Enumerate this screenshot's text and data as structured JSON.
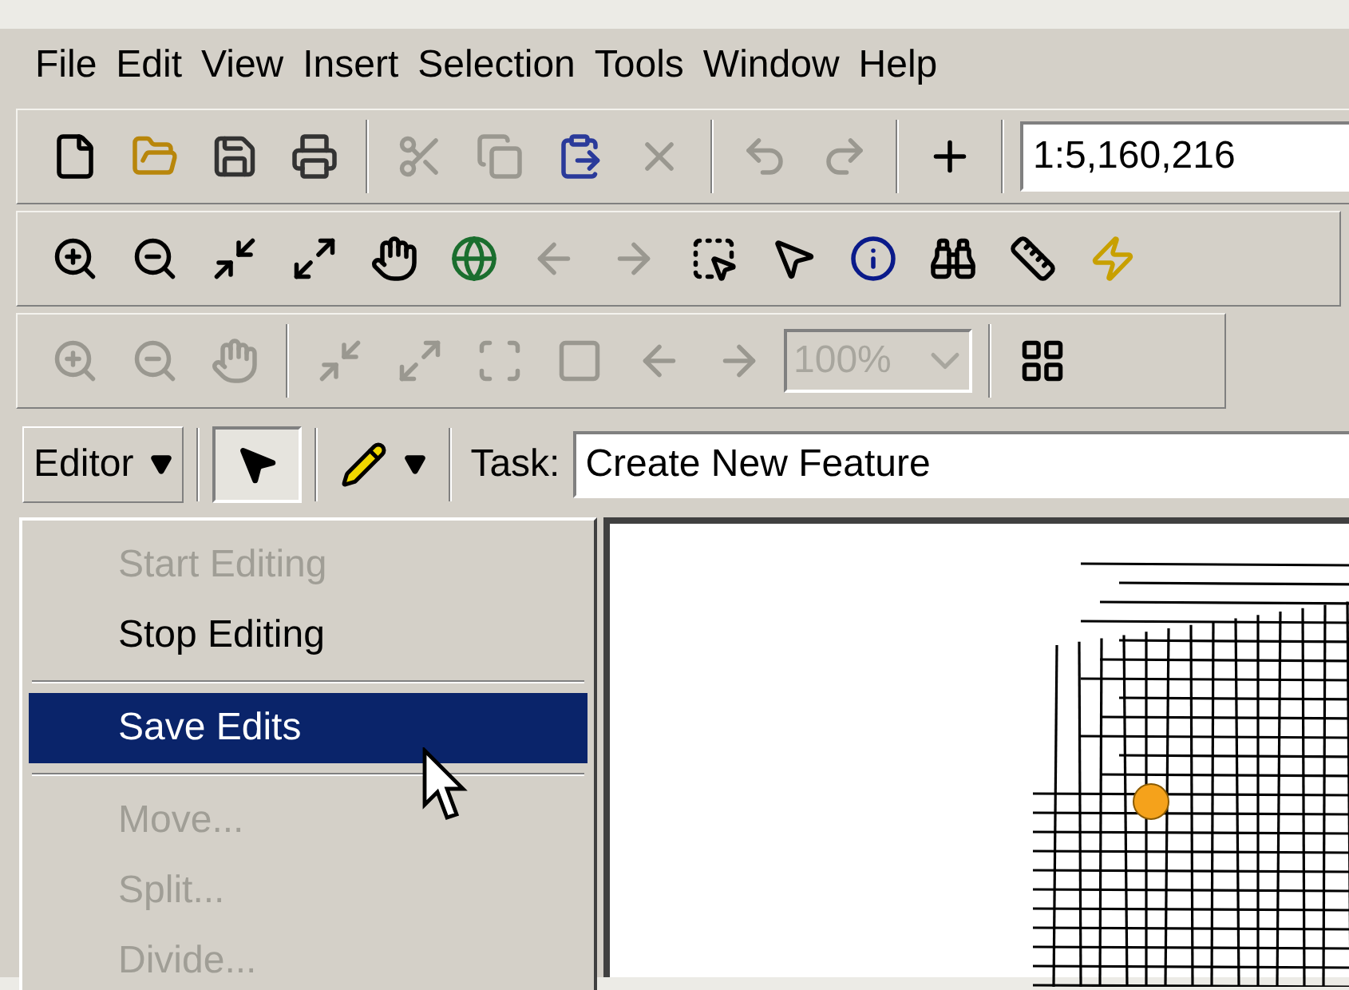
{
  "menu_bar": [
    {
      "label": "File"
    },
    {
      "label": "Edit"
    },
    {
      "label": "View"
    },
    {
      "label": "Insert"
    },
    {
      "label": "Selection"
    },
    {
      "label": "Tools"
    },
    {
      "label": "Window"
    },
    {
      "label": "Help"
    }
  ],
  "toolbars": [
    {
      "items": [
        {
          "kind": "button",
          "disabled": false
        },
        {
          "kind": "button",
          "disabled": false
        },
        {
          "kind": "button",
          "disabled": false
        },
        {
          "kind": "button",
          "disabled": false
        },
        {
          "kind": "separator"
        },
        {
          "kind": "button",
          "disabled": true
        },
        {
          "kind": "button",
          "disabled": true
        },
        {
          "kind": "button",
          "disabled": false
        },
        {
          "kind": "button",
          "disabled": true
        },
        {
          "kind": "separator"
        },
        {
          "kind": "button",
          "disabled": true
        },
        {
          "kind": "button",
          "disabled": true
        },
        {
          "kind": "separator"
        },
        {
          "kind": "button",
          "disabled": false
        },
        {
          "kind": "separator"
        },
        {
          "kind": "field",
          "value": "1:5,160,216",
          "disabled": false
        }
      ]
    },
    {
      "items": [
        {
          "kind": "button",
          "disabled": false
        },
        {
          "kind": "button",
          "disabled": false
        },
        {
          "kind": "button",
          "disabled": false
        },
        {
          "kind": "button",
          "disabled": false
        },
        {
          "kind": "button",
          "disabled": false
        },
        {
          "kind": "button",
          "disabled": false
        },
        {
          "kind": "button",
          "disabled": true
        },
        {
          "kind": "button",
          "disabled": true
        },
        {
          "kind": "button",
          "disabled": false
        },
        {
          "kind": "button",
          "disabled": false
        },
        {
          "kind": "button",
          "disabled": false
        },
        {
          "kind": "button",
          "disabled": false
        },
        {
          "kind": "button",
          "disabled": false
        },
        {
          "kind": "button",
          "disabled": false
        }
      ]
    },
    {
      "items": [
        {
          "kind": "button",
          "disabled": true
        },
        {
          "kind": "button",
          "disabled": true
        },
        {
          "kind": "button",
          "disabled": true
        },
        {
          "kind": "separator"
        },
        {
          "kind": "button",
          "disabled": true
        },
        {
          "kind": "button",
          "disabled": true
        },
        {
          "kind": "button",
          "disabled": true
        },
        {
          "kind": "button",
          "disabled": true
        },
        {
          "kind": "button",
          "disabled": true
        },
        {
          "kind": "button",
          "disabled": true
        },
        {
          "kind": "dropdown",
          "value": "100%",
          "disabled": true
        },
        {
          "kind": "separator"
        },
        {
          "kind": "button",
          "disabled": false
        }
      ]
    }
  ],
  "editor_toolbar": {
    "editor_menu": "Editor",
    "task_label": "Task:",
    "task_value": "Create New Feature"
  },
  "editor_menu": [
    {
      "kind": "item",
      "label": "Start Editing",
      "disabled": true,
      "selected": false
    },
    {
      "kind": "item",
      "label": "Stop Editing",
      "disabled": false,
      "selected": false
    },
    {
      "kind": "separator"
    },
    {
      "kind": "item",
      "label": "Save Edits",
      "disabled": false,
      "selected": true
    },
    {
      "kind": "separator"
    },
    {
      "kind": "item",
      "label": "Move...",
      "disabled": true,
      "selected": false
    },
    {
      "kind": "item",
      "label": "Split...",
      "disabled": true,
      "selected": false
    },
    {
      "kind": "item",
      "label": "Divide...",
      "disabled": true,
      "selected": false
    }
  ]
}
